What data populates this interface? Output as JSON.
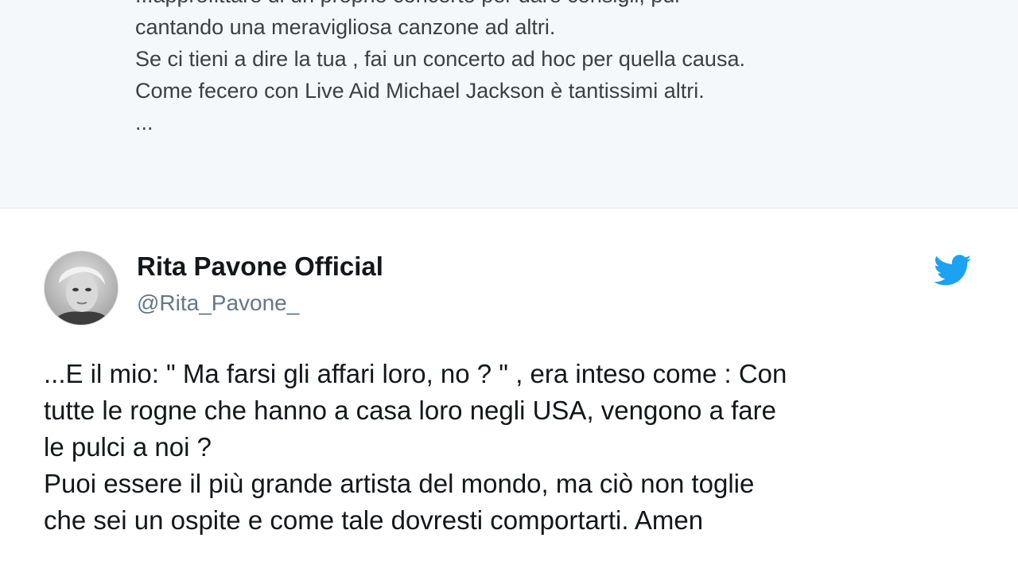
{
  "quoted_tweet": {
    "lines": [
      "...approfittare di un proprio concerto per dare consigli, pur",
      "cantando una meravigliosa canzone ad altri.",
      "Se ci tieni a dire la tua , fai un concerto ad hoc per quella causa.",
      "Come fecero con Live Aid Michael Jackson è tantissimi altri.",
      "..."
    ]
  },
  "tweet": {
    "display_name": "Rita Pavone Official",
    "handle": "@Rita_Pavone_",
    "avatar_icon": "avatar",
    "brand_icon": "twitter-bird-icon",
    "brand_color": "#1da1f2",
    "lines": [
      "...E il mio: \" Ma farsi gli affari loro, no ? \" , era inteso come : Con",
      "tutte le rogne che hanno a casa loro negli USA, vengono a fare",
      "le pulci a noi ?",
      "Puoi essere il più  grande artista del mondo, ma ciò  non toglie",
      "che sei un ospite e come tale dovresti  comportarti.  Amen"
    ]
  }
}
